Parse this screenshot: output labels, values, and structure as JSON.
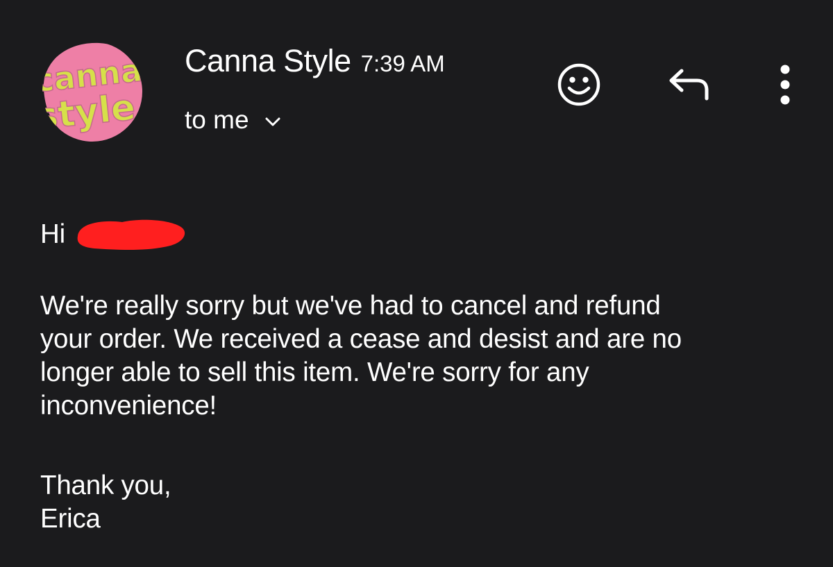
{
  "sender": {
    "name": "Canna Style",
    "time": "7:39 AM",
    "avatar_text": "canna style"
  },
  "recipient": {
    "label": "to me"
  },
  "toolbar": {
    "react_icon": "smiley-face-icon",
    "reply_icon": "reply-arrow-icon",
    "more_icon": "more-vertical-icon"
  },
  "message": {
    "greeting": "Hi",
    "greeting_name_redacted": true,
    "body_lines": [
      "We're really sorry but we've had to cancel and refund",
      "your order. We received a cease and desist and are no",
      "longer able to sell this item. We're sorry for any",
      "inconvenience!"
    ],
    "signoff": "Thank you,",
    "signature": "Erica"
  },
  "colors": {
    "background": "#1b1b1d",
    "text": "#ffffff",
    "avatar_pink": "#ee7fa6",
    "avatar_yellow": "#d6e04a",
    "redaction_red": "#ff1f1f"
  }
}
